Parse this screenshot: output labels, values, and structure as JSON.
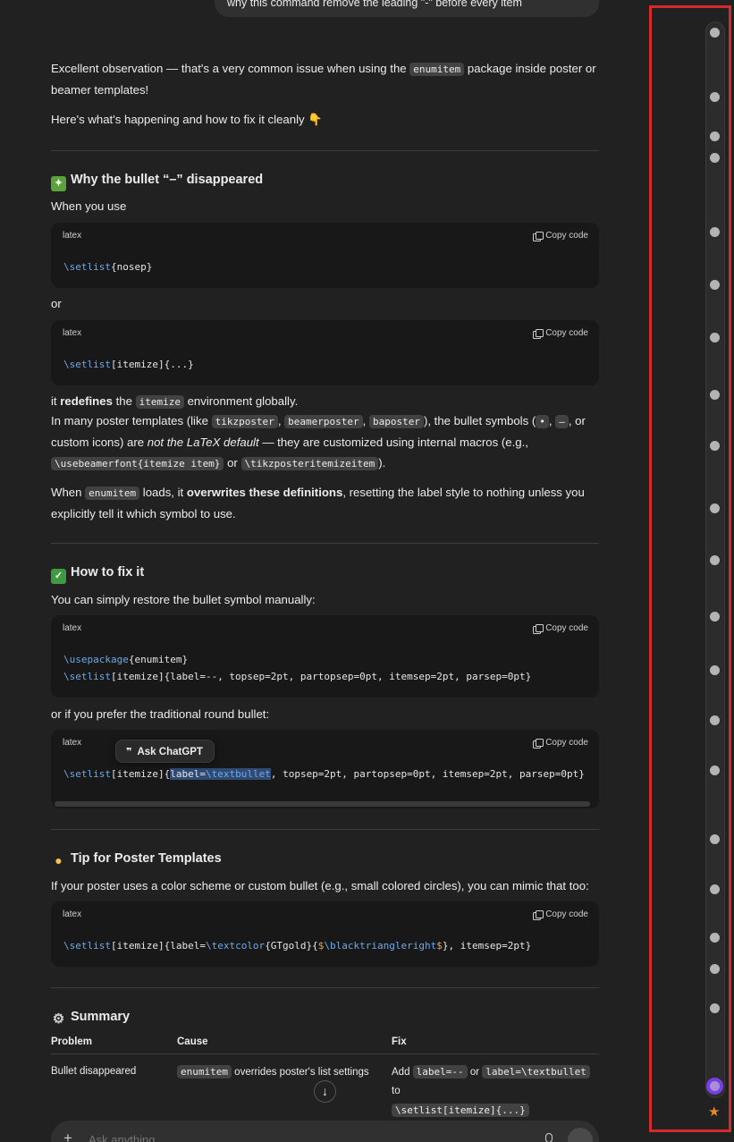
{
  "user_message": "why this command remove the leading \"-\" before every item",
  "intro": {
    "p1_text": "Excellent observation — that's a very common issue when using the ",
    "p1_code": "enumitem",
    "p1_text2": " package inside poster or beamer templates!",
    "p2": "Here's what's happening and how to fix it cleanly 👇"
  },
  "section1": {
    "title": "Why the bullet “–” disappeared",
    "icon": "puzzle-icon",
    "when_you_use": "When you use",
    "or": "or",
    "code1": {
      "lang": "latex",
      "copy_label": "Copy code",
      "cmd": "\\setlist",
      "rest": "{nosep}"
    },
    "code2": {
      "lang": "latex",
      "copy_label": "Copy code",
      "cmd": "\\setlist",
      "rest": "[itemize]{...}"
    },
    "p3_a": "it ",
    "p3_bold": "redefines",
    "p3_b": " the ",
    "p3_code": "itemize",
    "p3_c": " environment globally.",
    "p4_a": "In many poster templates (like ",
    "p4_code1": "tikzposter",
    "p4_sep1": ", ",
    "p4_code2": "beamerposter",
    "p4_sep2": ", ",
    "p4_code3": "baposter",
    "p4_b": "), the bullet symbols (",
    "p4_code4": "•",
    "p4_sep3": ", ",
    "p4_code5": "–",
    "p4_c": ", or custom icons) are ",
    "p4_italic": "not the LaTeX default",
    "p4_d": " — they are customized using internal macros (e.g., ",
    "p4_code6": "\\usebeamerfont{itemize item}",
    "p4_e": " or ",
    "p4_code7": "\\tikzposteritemizeitem",
    "p4_f": ").",
    "p5_a": "When ",
    "p5_code": "enumitem",
    "p5_b": " loads, it ",
    "p5_bold": "overwrites these definitions",
    "p5_c": ", resetting the label style to nothing unless you explicitly tell it which symbol to use."
  },
  "section2": {
    "title": "How to fix it",
    "icon": "check-icon",
    "intro": "You can simply restore the bullet symbol manually:",
    "code1": {
      "lang": "latex",
      "copy_label": "Copy code",
      "line1_cmd": "\\usepackage",
      "line1_rest": "{enumitem}",
      "line2_cmd": "\\setlist",
      "line2_rest": "[itemize]{label=--, topsep=2pt, partopsep=0pt, itemsep=2pt, parsep=0pt}"
    },
    "or_prefer": "or if you prefer the traditional round bullet:",
    "code2": {
      "lang": "latex",
      "copy_label": "Copy code",
      "cmd": "\\setlist",
      "a": "[itemize]{",
      "sel1": "label=",
      "sel2": "\\textbullet",
      "rest": ", topsep=2pt, partopsep=0pt, itemsep=2pt, parsep=0pt}"
    },
    "tooltip": "Ask ChatGPT"
  },
  "section3": {
    "title": "Tip for Poster Templates",
    "icon": "lightbulb-icon",
    "intro": "If your poster uses a color scheme or custom bullet (e.g., small colored circles), you can mimic that too:",
    "code": {
      "lang": "latex",
      "copy_label": "Copy code",
      "cmd": "\\setlist",
      "a": "[itemize]{label=",
      "cmd2": "\\textcolor",
      "b": "{GTgold}{",
      "d1": "$",
      "cmd3": "\\blacktriangleright",
      "d2": "$",
      "c": "}, itemsep=2pt}"
    }
  },
  "section4": {
    "title": "Summary",
    "icon": "gear-icon",
    "headers": [
      "Problem",
      "Cause",
      "Fix"
    ],
    "row": {
      "problem": "Bullet disappeared",
      "cause_code": "enumitem",
      "cause_text": " overrides poster's list settings",
      "fix_a": "Add ",
      "fix_code1": "label=--",
      "fix_b": " or ",
      "fix_code2": "label=\\textbullet",
      "fix_c": " to ",
      "fix_code3": "\\setlist[itemize]{...}"
    }
  },
  "composer": {
    "placeholder": "Ask anything"
  },
  "colors": {
    "accent_keyword": "#6ea8e8",
    "rail_highlight": "#d42a2a",
    "rail_active": "#7a3fe4",
    "star": "#e5892b"
  }
}
